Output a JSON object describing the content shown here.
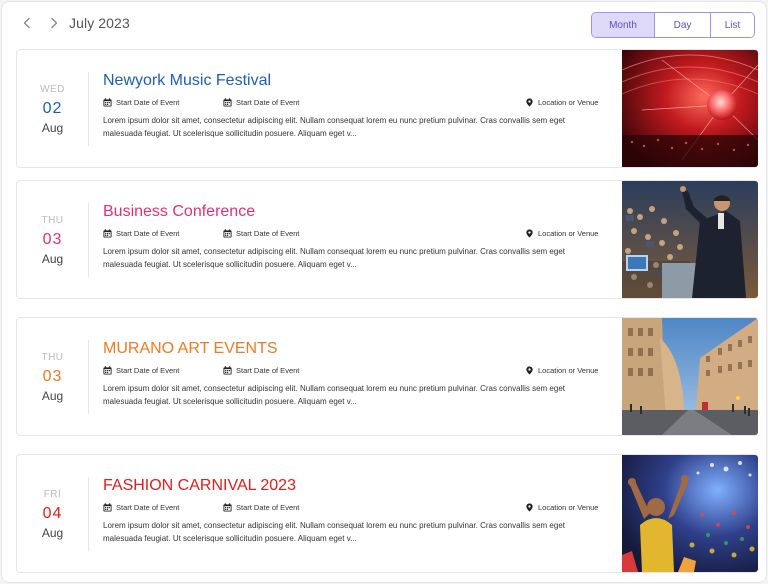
{
  "header": {
    "month_label": "July 2023",
    "prev_icon": "chevron-left-icon",
    "next_icon": "chevron-right-icon",
    "views": [
      {
        "label": "Month",
        "active": true
      },
      {
        "label": "Day",
        "active": false
      },
      {
        "label": "List",
        "active": false
      }
    ]
  },
  "colors": {
    "accent": "#5a52c7",
    "accent_bg": "#ddd9f7"
  },
  "events": [
    {
      "dow": "WED",
      "day": "02",
      "month": "Aug",
      "title": "Newyork Music Festival",
      "color": "#1c5fb0",
      "start_label": "Start Date of Event",
      "end_label": "Start Date of Event",
      "location_label": "Location or Venue",
      "description": "Lorem ipsum dolor sit amet, consectetur adipiscing elit. Nullam consequat lorem eu nunc pretium pulvinar. Cras convallis sem eget malesuada feugiat. Ut scelerisque sollicitudin posuere. Aliquam eget v...",
      "image": "concert-hall-photo"
    },
    {
      "dow": "THU",
      "day": "03",
      "month": "Aug",
      "title": "Business Conference",
      "color": "#e0307a",
      "start_label": "Start Date of Event",
      "end_label": "Start Date of Event",
      "location_label": "Location or Venue",
      "description": "Lorem ipsum dolor sit amet, consectetur adipiscing elit. Nullam consequat lorem eu nunc pretium pulvinar. Cras convallis sem eget malesuada feugiat. Ut scelerisque sollicitudin posuere. Aliquam eget v...",
      "image": "conference-speaker-photo"
    },
    {
      "dow": "THU",
      "day": "03",
      "month": "Aug",
      "title": "MURANO ART EVENTS",
      "color": "#f07a1e",
      "start_label": "Start Date of Event",
      "end_label": "Start Date of Event",
      "location_label": "Location or Venue",
      "description": "Lorem ipsum dolor sit amet, consectetur adipiscing elit. Nullam consequat lorem eu nunc pretium pulvinar. Cras convallis sem eget malesuada feugiat. Ut scelerisque sollicitudin posuere. Aliquam eget v...",
      "image": "city-street-photo"
    },
    {
      "dow": "FRI",
      "day": "04",
      "month": "Aug",
      "title": "FASHION CARNIVAL 2023",
      "color": "#e31c1c",
      "start_label": "Start Date of Event",
      "end_label": "Start Date of Event",
      "location_label": "Location or Venue",
      "description": "Lorem ipsum dolor sit amet, consectetur adipiscing elit. Nullam consequat lorem eu nunc pretium pulvinar. Cras convallis sem eget malesuada feugiat. Ut scelerisque sollicitudin posuere. Aliquam eget v...",
      "image": "stadium-fans-photo"
    }
  ]
}
